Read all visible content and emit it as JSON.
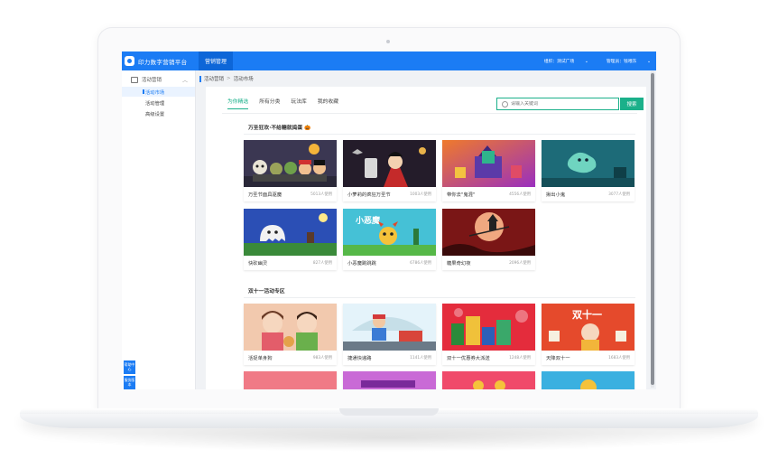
{
  "app": {
    "brand": "印力数字营销平台",
    "nav_tab": "营销管理",
    "org_label": "组织：测试广场",
    "user_label": "管理员：钱喂东"
  },
  "sidebar": {
    "group": "活动营销",
    "items": [
      {
        "label": "活动市场",
        "active": true
      },
      {
        "label": "活动管理",
        "active": false
      },
      {
        "label": "高级设置",
        "active": false
      }
    ],
    "help_buttons": [
      "帮助中心",
      "服务版本"
    ]
  },
  "breadcrumb": [
    "活动营销",
    "活动市场"
  ],
  "tabs": [
    {
      "label": "为你精选",
      "active": true
    },
    {
      "label": "所有分类",
      "active": false
    },
    {
      "label": "玩法库",
      "active": false
    },
    {
      "label": "我的收藏",
      "active": false
    }
  ],
  "search": {
    "placeholder": "请输入关键词",
    "button": "搜索"
  },
  "sections": [
    {
      "title": "万圣狂欢·不给糖就捣蛋 🎃",
      "cards": [
        {
          "name": "万圣节面具驱魔",
          "uses": "5013人使用",
          "color": "#3a3550"
        },
        {
          "name": "小萝莉的疯狂万圣节",
          "uses": "1003人使用",
          "color": "#2a1f2e"
        },
        {
          "name": "带你去\"鬼混\"",
          "uses": "4556人使用",
          "color": "#e0522f"
        },
        {
          "name": "揪出小鬼",
          "uses": "3077人使用",
          "color": "#1c6e7a"
        },
        {
          "name": "快砍幽灵",
          "uses": "827人使用",
          "color": "#2f4fb2"
        },
        {
          "name": "小恶魔跳跳跳",
          "uses": "6786人使用",
          "color": "#39b3c9"
        },
        {
          "name": "糖果奇幻夜",
          "uses": "2096人使用",
          "color": "#8c1a1a"
        }
      ]
    },
    {
      "title": "双十一活动专区",
      "cards": [
        {
          "name": "活捉单身狗",
          "uses": "983人使用",
          "color": "#e9b59a"
        },
        {
          "name": "捷通快递路",
          "uses": "1141人使用",
          "color": "#dff0f8"
        },
        {
          "name": "双十一优惠券大派送",
          "uses": "1248人使用",
          "color": "#e02b3a"
        },
        {
          "name": "天降双十一",
          "uses": "1683人使用",
          "color": "#e44e2c"
        }
      ]
    }
  ]
}
